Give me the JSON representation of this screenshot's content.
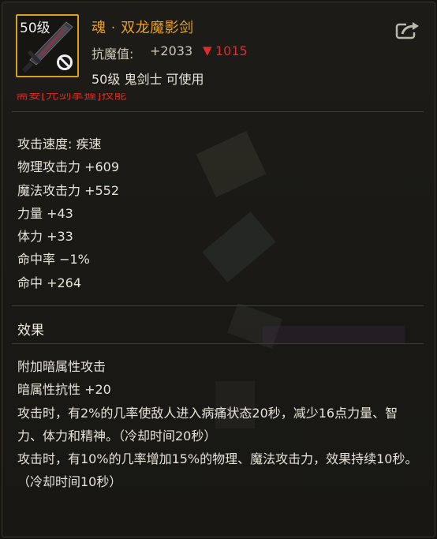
{
  "item": {
    "level_badge": "50级",
    "name": "魂 · 双龙魔影剑",
    "resist_label": "抗魔值:",
    "resist_value": "+2033",
    "resist_drop_arrow": "▼",
    "resist_drop": "1015",
    "requirement": "50级 鬼剑士 可使用",
    "skill_requirement": "需要[光剑掌握]技能"
  },
  "icons": {
    "item_icon": "sword-icon",
    "unusable_icon": "no-entry-icon",
    "share_icon": "share-icon"
  },
  "stats": [
    "攻击速度: 疾速",
    "物理攻击力 +609",
    "魔法攻击力 +552",
    "力量 +43",
    "体力 +33",
    "命中率 −1%",
    "命中 +264"
  ],
  "effects": {
    "title": "效果",
    "lines": [
      "附加暗属性攻击",
      "暗属性抗性 +20",
      "攻击时，有2%的几率使敌人进入病痛状态20秒，减少16点力量、智力、体力和精神。（冷却时间20秒）",
      "攻击时，有10%的几率增加15%的物理、魔法攻击力，效果持续10秒。（冷却时间10秒）"
    ]
  },
  "colors": {
    "title": "#e8a020",
    "drop": "#e02c2c",
    "frame": "#d9a21a",
    "text": "#e8e3d8"
  }
}
